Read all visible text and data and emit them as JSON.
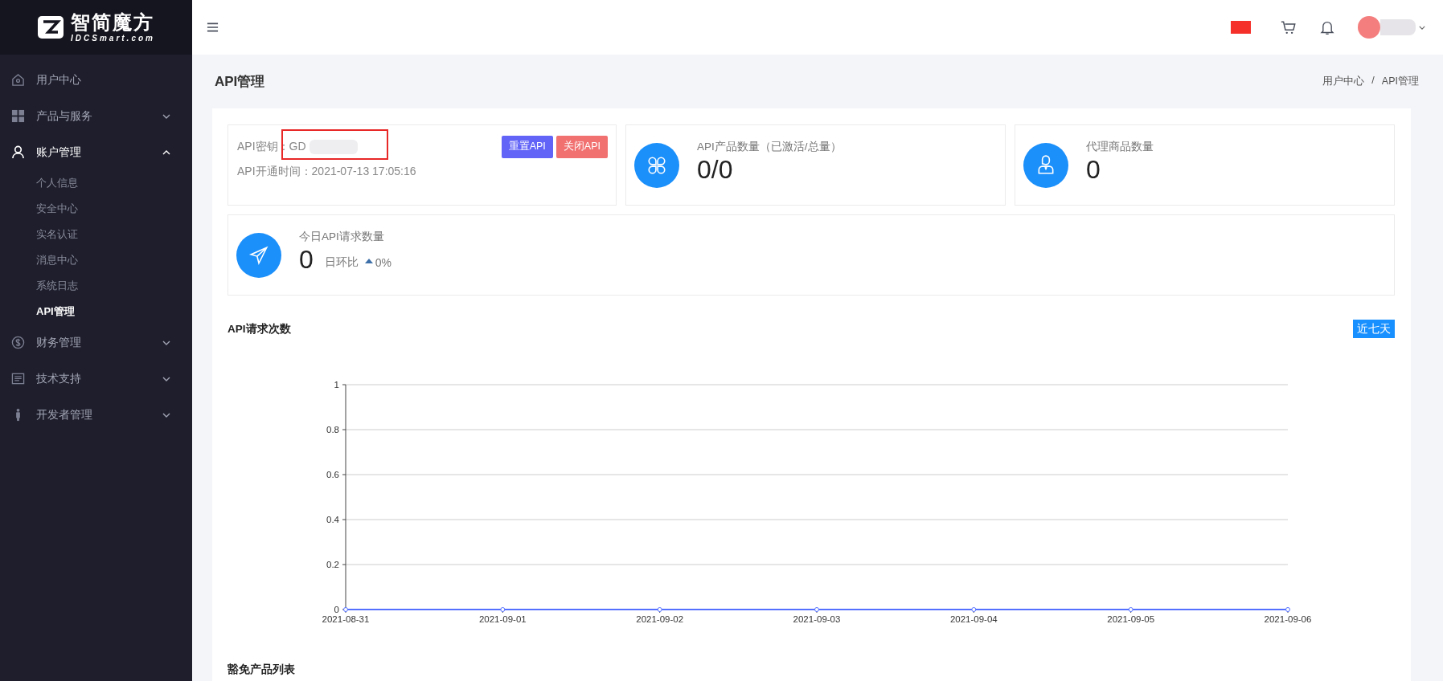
{
  "brand": {
    "name": "智简魔方",
    "domain": "IDCSmart.com"
  },
  "sidebar": {
    "items": [
      {
        "label": "用户中心",
        "kind": "link"
      },
      {
        "label": "产品与服务",
        "kind": "group",
        "expanded": false
      },
      {
        "label": "账户管理",
        "kind": "group",
        "expanded": true,
        "children": [
          {
            "label": "个人信息",
            "selected": false
          },
          {
            "label": "安全中心",
            "selected": false
          },
          {
            "label": "实名认证",
            "selected": false
          },
          {
            "label": "消息中心",
            "selected": false
          },
          {
            "label": "系统日志",
            "selected": false
          },
          {
            "label": "API管理",
            "selected": true
          }
        ]
      },
      {
        "label": "财务管理",
        "kind": "group",
        "expanded": false
      },
      {
        "label": "技术支持",
        "kind": "group",
        "expanded": false
      },
      {
        "label": "开发者管理",
        "kind": "group",
        "expanded": false
      }
    ]
  },
  "page": {
    "title": "API管理",
    "breadcrumb": [
      "用户中心",
      "API管理"
    ],
    "breadcrumb_separator": "/"
  },
  "key_card": {
    "key_label": "API密钥：GD",
    "opened_label": "API开通时间：2021-07-13 17:05:16",
    "buttons": [
      {
        "label": "重置API",
        "kind": "primary"
      },
      {
        "label": "关闭API",
        "kind": "danger"
      }
    ]
  },
  "stats": [
    {
      "label": "API产品数量（已激活/总量）",
      "value": "0/0"
    },
    {
      "label": "代理商品数量",
      "value": "0"
    }
  ],
  "today": {
    "label": "今日API请求数量",
    "value": "0",
    "compare_label": "日环比",
    "rising": true,
    "change": "0%"
  },
  "chart_section": {
    "title": "API请求次数",
    "range_button": "近七天",
    "chart_data": {
      "type": "line",
      "categories": [
        "2021-08-31",
        "2021-09-01",
        "2021-09-02",
        "2021-09-03",
        "2021-09-04",
        "2021-09-05",
        "2021-09-06"
      ],
      "series": [
        {
          "color": "#5470ff",
          "marker": true,
          "values": [
            0,
            0,
            0,
            0,
            0,
            0,
            0
          ]
        }
      ],
      "ylim": [
        0,
        1
      ],
      "yticks": [
        0,
        0.2,
        0.4,
        0.6,
        0.8,
        1
      ],
      "grid": true
    }
  },
  "exempt_section": {
    "title": "豁免产品列表"
  }
}
